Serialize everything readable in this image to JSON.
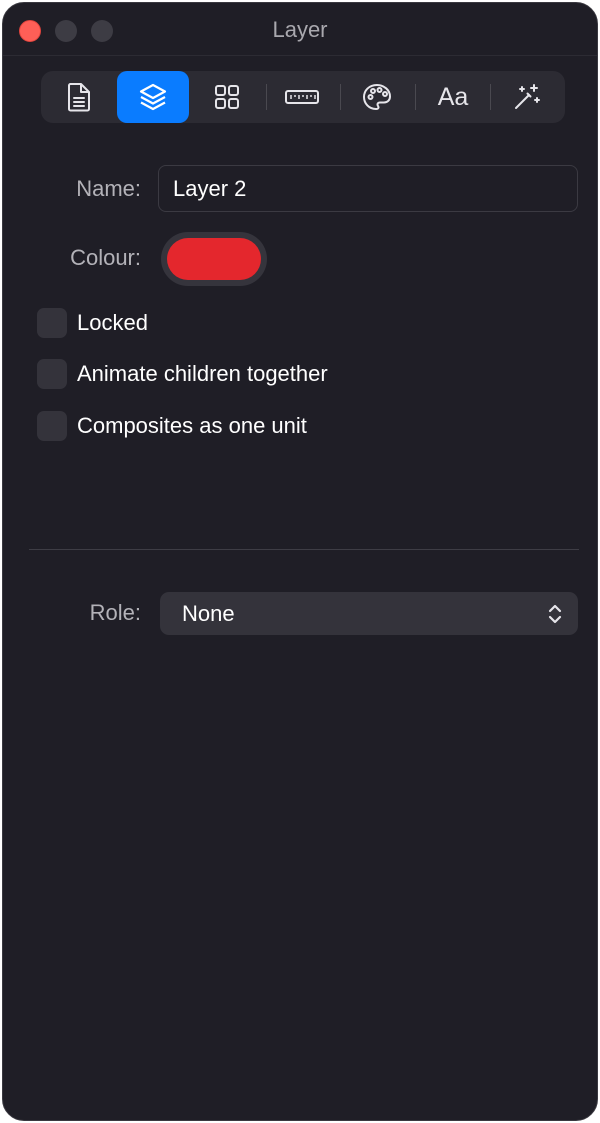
{
  "window": {
    "title": "Layer"
  },
  "toolbar": {
    "items": [
      {
        "icon": "document-icon",
        "active": false
      },
      {
        "icon": "layers-icon",
        "active": true
      },
      {
        "icon": "grid-icon",
        "active": false
      },
      {
        "icon": "ruler-icon",
        "active": false
      },
      {
        "icon": "palette-icon",
        "active": false
      },
      {
        "icon": "typography-icon",
        "text": "Aa",
        "active": false
      },
      {
        "icon": "magic-wand-icon",
        "active": false
      }
    ]
  },
  "form": {
    "name_label": "Name:",
    "name_value": "Layer 2",
    "colour_label": "Colour:",
    "colour_value": "#e4272d",
    "checkboxes": [
      {
        "label": "Locked",
        "checked": false
      },
      {
        "label": "Animate children together",
        "checked": false
      },
      {
        "label": "Composites as one unit",
        "checked": false
      }
    ],
    "role_label": "Role:",
    "role_value": "None"
  },
  "colors": {
    "accent": "#0a7cff",
    "background": "#1f1e26",
    "close_button": "#fe5f57"
  }
}
